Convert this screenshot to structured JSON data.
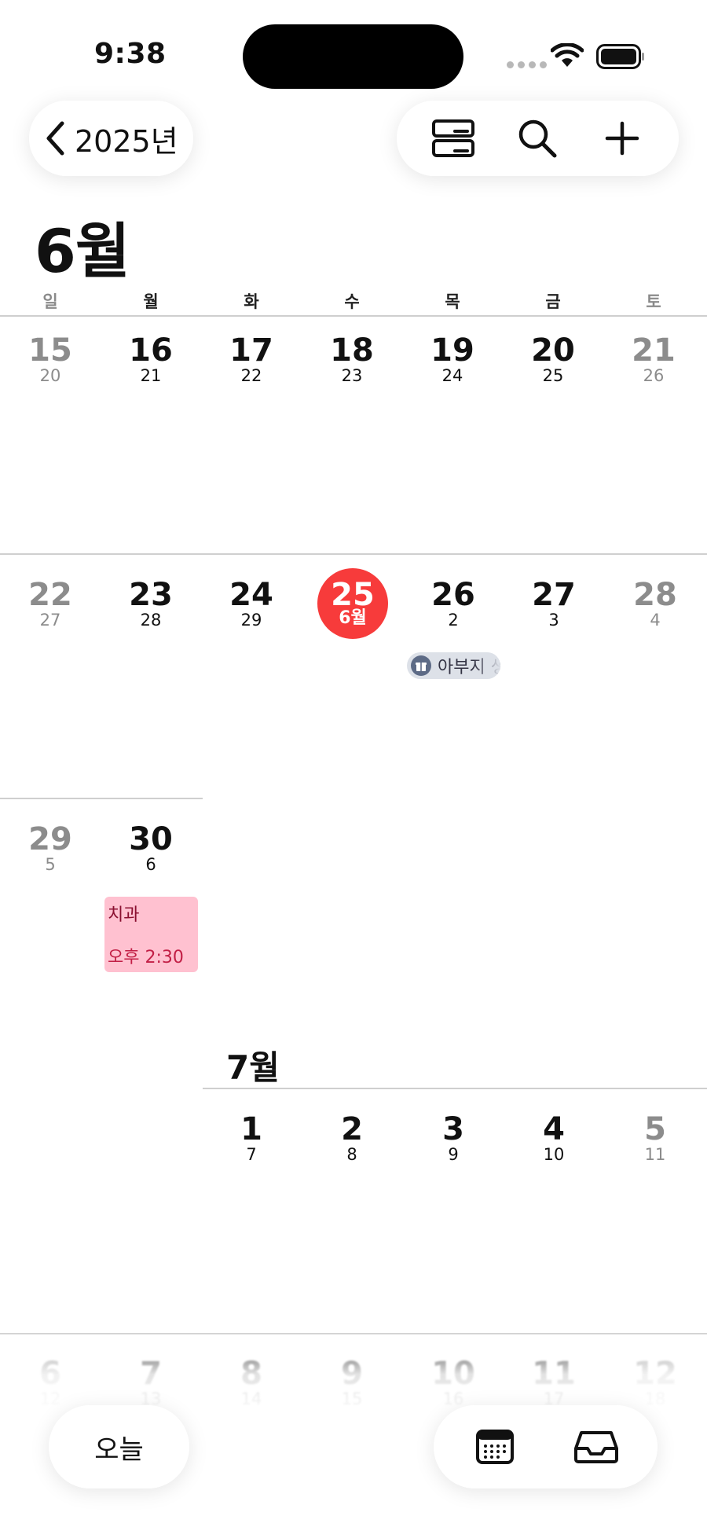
{
  "status": {
    "time": "9:38"
  },
  "nav": {
    "year_label": "2025년"
  },
  "month_title": "6월",
  "weekdays": [
    "일",
    "월",
    "화",
    "수",
    "목",
    "금",
    "토"
  ],
  "weeks": [
    {
      "days": [
        {
          "n": "15",
          "s": "20"
        },
        {
          "n": "16",
          "s": "21"
        },
        {
          "n": "17",
          "s": "22"
        },
        {
          "n": "18",
          "s": "23"
        },
        {
          "n": "19",
          "s": "24"
        },
        {
          "n": "20",
          "s": "25"
        },
        {
          "n": "21",
          "s": "26"
        }
      ]
    },
    {
      "days": [
        {
          "n": "22",
          "s": "27"
        },
        {
          "n": "23",
          "s": "28"
        },
        {
          "n": "24",
          "s": "29"
        },
        {
          "n": "25",
          "s": "6월"
        },
        {
          "n": "26",
          "s": "2"
        },
        {
          "n": "27",
          "s": "3"
        },
        {
          "n": "28",
          "s": "4"
        }
      ]
    },
    {
      "days": [
        {
          "n": "29",
          "s": "5"
        },
        {
          "n": "30",
          "s": "6"
        }
      ]
    }
  ],
  "event_chip": {
    "text": "아부지 생신"
  },
  "event": {
    "title": "치과",
    "time": "오후 2:30"
  },
  "month2_title": "7월",
  "july_week1": [
    {
      "n": "1",
      "s": "7"
    },
    {
      "n": "2",
      "s": "8"
    },
    {
      "n": "3",
      "s": "9"
    },
    {
      "n": "4",
      "s": "10"
    },
    {
      "n": "5",
      "s": "11"
    }
  ],
  "july_week2": [
    {
      "n": "6",
      "s": "12"
    },
    {
      "n": "7",
      "s": "13"
    },
    {
      "n": "8",
      "s": "14"
    },
    {
      "n": "9",
      "s": "15"
    },
    {
      "n": "10",
      "s": "16"
    },
    {
      "n": "11",
      "s": "17"
    },
    {
      "n": "12",
      "s": "18"
    }
  ],
  "bottom": {
    "today_label": "오늘"
  },
  "colors": {
    "today": "#f73b3b",
    "event": "#ffc1d0",
    "chip": "#dde1e8"
  }
}
